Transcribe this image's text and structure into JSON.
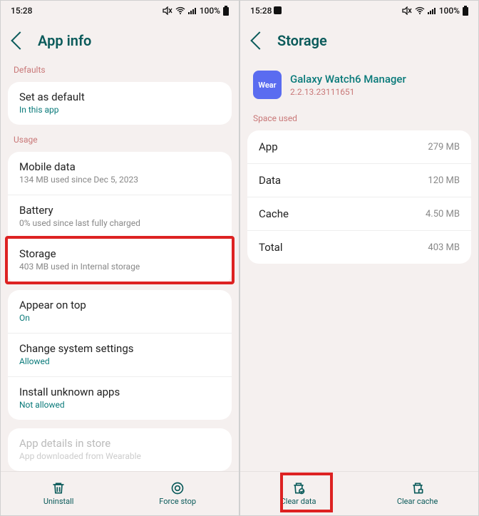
{
  "left": {
    "status": {
      "time": "15:28",
      "battery": "100%"
    },
    "title": "App info",
    "sections": {
      "defaults": "Defaults",
      "usage": "Usage"
    },
    "defaults_row": {
      "title": "Set as default",
      "sub": "In this app"
    },
    "usage_rows": {
      "mobile": {
        "title": "Mobile data",
        "sub": "134 MB used since Dec 5, 2023"
      },
      "battery": {
        "title": "Battery",
        "sub": "0% used since last fully charged"
      },
      "storage": {
        "title": "Storage",
        "sub": "403 MB used in Internal storage"
      }
    },
    "perm_rows": {
      "appear": {
        "title": "Appear on top",
        "sub": "On"
      },
      "change": {
        "title": "Change system settings",
        "sub": "Allowed"
      },
      "install": {
        "title": "Install unknown apps",
        "sub": "Not allowed"
      }
    },
    "store_row": {
      "title": "App details in store",
      "sub": "App downloaded from Wearable"
    },
    "bottom": {
      "uninstall": "Uninstall",
      "force": "Force stop"
    }
  },
  "right": {
    "status": {
      "time": "15:28",
      "battery": "100%"
    },
    "title": "Storage",
    "app": {
      "icon": "Wear",
      "name": "Galaxy Watch6 Manager",
      "version": "2.2.13.23111651"
    },
    "section": "Space used",
    "rows": {
      "app": {
        "key": "App",
        "val": "279 MB"
      },
      "data": {
        "key": "Data",
        "val": "120 MB"
      },
      "cache": {
        "key": "Cache",
        "val": "4.50 MB"
      },
      "total": {
        "key": "Total",
        "val": "403 MB"
      }
    },
    "bottom": {
      "clear_data": "Clear data",
      "clear_cache": "Clear cache"
    }
  }
}
